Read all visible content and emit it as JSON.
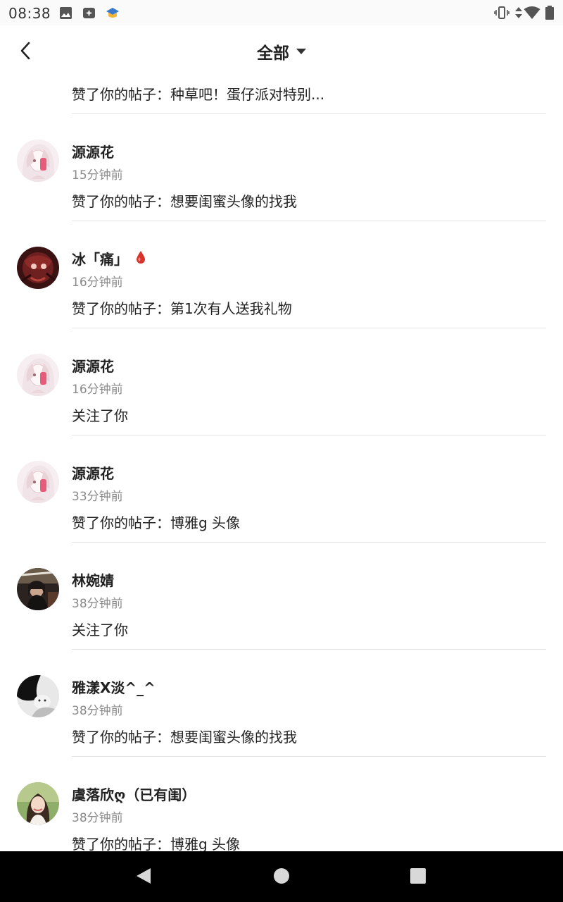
{
  "status_bar": {
    "time": "08:38",
    "left_icons": [
      "image-icon",
      "add-box-icon",
      "app-notification-icon"
    ],
    "right_icons": [
      "vibrate-icon",
      "data-arrows-icon",
      "wifi-icon",
      "battery-icon"
    ]
  },
  "header": {
    "title": "全部",
    "back_icon": "back-arrow-icon",
    "dropdown_icon": "caret-down-icon"
  },
  "notifications": {
    "first_partial_action": "赞了你的帖子：种草吧！蛋仔派对特别...",
    "items": [
      {
        "name": "源源花",
        "time": "15分钟前",
        "action": "赞了你的帖子：想要闺蜜头像的找我",
        "avatar": "anime-girl"
      },
      {
        "name": "冰「痛」",
        "time": "16分钟前",
        "action": "赞了你的帖子：第1次有人送我礼物",
        "avatar": "dark-red",
        "badge_icon": "blood-drop-icon"
      },
      {
        "name": "源源花",
        "time": "16分钟前",
        "action": "关注了你",
        "avatar": "anime-girl"
      },
      {
        "name": "源源花",
        "time": "33分钟前",
        "action": "赞了你的帖子：博雅g 头像",
        "avatar": "anime-girl"
      },
      {
        "name": "林婉婧",
        "time": "38分钟前",
        "action": "关注了你",
        "avatar": "dark-photo"
      },
      {
        "name": "雅漾X淡^_^",
        "time": "38分钟前",
        "action": "赞了你的帖子：想要闺蜜头像的找我",
        "avatar": "bw-photo"
      },
      {
        "name": "虞落欣ღ（已有闺）",
        "time": "38分钟前",
        "action": "赞了你的帖子：博雅g 头像",
        "avatar": "green-photo"
      }
    ]
  },
  "nav_bar": {
    "icons": [
      "nav-back-icon",
      "nav-home-icon",
      "nav-recents-icon"
    ]
  },
  "colors": {
    "divider": "#e6e6e6",
    "secondary_text": "#8a8a8a",
    "badge_red": "#d9342b"
  }
}
